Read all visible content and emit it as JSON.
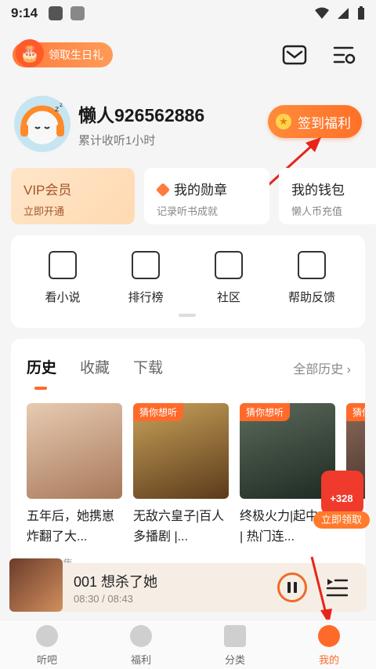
{
  "statusbar": {
    "time": "9:14"
  },
  "topbar": {
    "birthday_label": "领取生日礼"
  },
  "profile": {
    "username": "懒人926562886",
    "listen_time": "累计收听1小时",
    "signin_label": "签到福利"
  },
  "cards": {
    "vip": {
      "title": "VIP会员",
      "subtitle": "立即开通"
    },
    "medal": {
      "title": "我的勋章",
      "subtitle": "记录听书成就"
    },
    "wallet": {
      "title": "我的钱包",
      "subtitle": "懒人币充值"
    }
  },
  "menu": {
    "items": [
      {
        "label": "看小说",
        "icon": "book-icon"
      },
      {
        "label": "排行榜",
        "icon": "chart-icon"
      },
      {
        "label": "社区",
        "icon": "chat-icon"
      },
      {
        "label": "帮助反馈",
        "icon": "feedback-icon"
      }
    ]
  },
  "history": {
    "tabs": [
      "历史",
      "收藏",
      "下载"
    ],
    "all_label": "全部历史",
    "books": [
      {
        "title": "五年后，她携崽炸翻了大...",
        "tag": "",
        "cover_color": "#c9a487"
      },
      {
        "title": "无敌六皇子|百人多播剧 |...",
        "tag": "猜你想听",
        "cover_color": "#8a6a2e"
      },
      {
        "title": "终极火力|起中文 | 热门连...",
        "tag": "猜你想听",
        "cover_color": "#3a4a3a"
      },
      {
        "title": "",
        "tag": "猜你",
        "cover_color": "#6b4b3a"
      }
    ],
    "partial_line": "听至第1集"
  },
  "redpacket": {
    "amount": "+328",
    "button_label": "立即领取"
  },
  "player": {
    "title": "001 想杀了她",
    "time": "08:30 / 08:43"
  },
  "tabbar": {
    "items": [
      "听吧",
      "福利",
      "分类",
      "我的"
    ]
  }
}
